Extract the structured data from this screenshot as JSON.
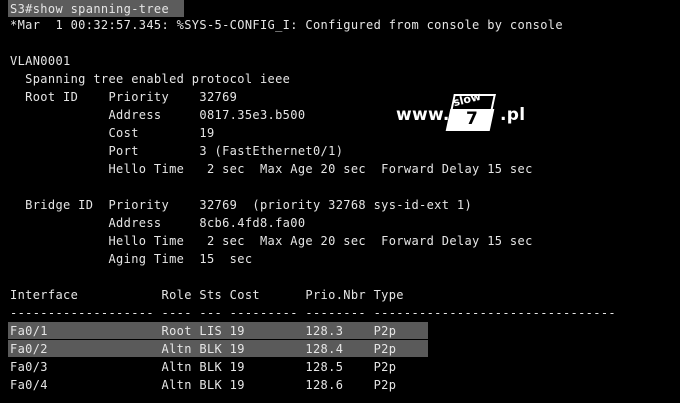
{
  "command": "S3#show spanning-tree",
  "log_message": "*Mar  1 00:32:57.345: %SYS-5-CONFIG_I: Configured from console by console",
  "vlan": "VLAN0001",
  "protocol_line": "  Spanning tree enabled protocol ieee",
  "root_id": {
    "priority_line": "  Root ID    Priority    32769",
    "address_line": "             Address     0817.35e3.b500",
    "cost_line": "             Cost        19",
    "port_line": "             Port        3 (FastEthernet0/1)",
    "hello_line": "             Hello Time   2 sec  Max Age 20 sec  Forward Delay 15 sec"
  },
  "bridge_id": {
    "priority_line": "  Bridge ID  Priority    32769  (priority 32768 sys-id-ext 1)",
    "address_line": "             Address     8cb6.4fd8.fa00",
    "hello_line": "             Hello Time   2 sec  Max Age 20 sec  Forward Delay 15 sec",
    "aging_line": "             Aging Time  15  sec"
  },
  "table": {
    "header": "Interface           Role Sts Cost      Prio.Nbr Type",
    "separator": "------------------- ---- --- --------- -------- --------------------------------",
    "rows": [
      "Fa0/1               Root LIS 19        128.3    P2p",
      "Fa0/2               Altn BLK 19        128.4    P2p",
      "Fa0/3               Altn BLK 19        128.5    P2p",
      "Fa0/4               Altn BLK 19        128.6    P2p"
    ]
  },
  "watermark": {
    "prefix": "www.",
    "badge_top": "slow",
    "badge_bottom": "7",
    "suffix": ".pl"
  },
  "colors": {
    "background": "#000000",
    "text": "#e6e6e6",
    "highlight": "#5a5a5a"
  }
}
